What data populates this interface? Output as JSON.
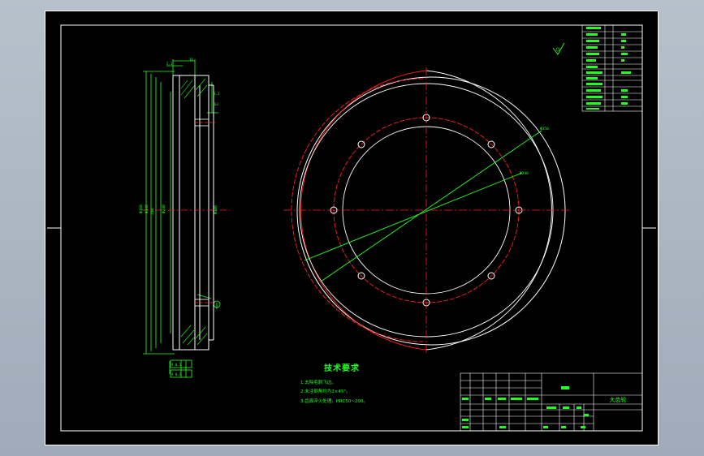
{
  "colors": {
    "viewport_bg": "#a9b4c1",
    "canvas_bg": "#000000",
    "frame": "#ffffff",
    "dimension": "#22ff22",
    "center_line": "#ff2020",
    "part": "#ffffff"
  },
  "part_name": "大齿轮",
  "tech_requirements": {
    "title": "技术要求",
    "items": [
      "1.去除毛刺飞边。",
      "2.未注倒角均为2×45°。",
      "3.齿面淬火处理，HRC50~200。"
    ]
  }
}
